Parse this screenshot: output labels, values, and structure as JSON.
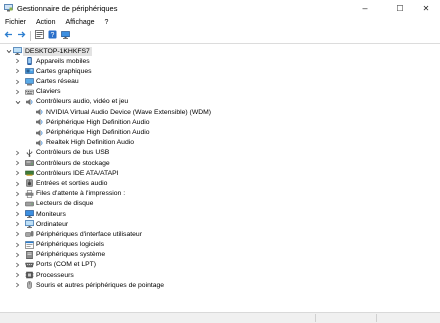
{
  "window": {
    "title": "Gestionnaire de périphériques",
    "controls": {
      "minimize": "–",
      "maximize": "☐",
      "close": "✕"
    }
  },
  "menu": [
    {
      "label": "Fichier"
    },
    {
      "label": "Action"
    },
    {
      "label": "Affichage"
    },
    {
      "label": "?"
    }
  ],
  "toolbar": [
    {
      "name": "back-button",
      "icon": "arrow-left-icon"
    },
    {
      "name": "forward-button",
      "icon": "arrow-right-icon"
    },
    {
      "sep": true
    },
    {
      "name": "properties-button",
      "icon": "properties-icon"
    },
    {
      "name": "help-button",
      "icon": "help-icon"
    },
    {
      "name": "scan-hardware-button",
      "icon": "monitor-icon"
    }
  ],
  "tree": {
    "root": {
      "label": "DESKTOP-1KHKFS7",
      "icon": "computer-icon",
      "expanded": true
    },
    "items": [
      {
        "label": "Appareils mobiles",
        "icon": "mobile-device-icon",
        "level": 1,
        "state": "collapsed"
      },
      {
        "label": "Cartes graphiques",
        "icon": "display-adapter-icon",
        "level": 1,
        "state": "collapsed"
      },
      {
        "label": "Cartes réseau",
        "icon": "network-adapter-icon",
        "level": 1,
        "state": "collapsed"
      },
      {
        "label": "Claviers",
        "icon": "keyboard-icon",
        "level": 1,
        "state": "collapsed"
      },
      {
        "label": "Contrôleurs audio, vidéo et jeu",
        "icon": "audio-icon",
        "level": 1,
        "state": "expanded"
      },
      {
        "label": "NVIDIA Virtual Audio Device (Wave Extensible) (WDM)",
        "icon": "audio-icon",
        "level": 2,
        "state": "leaf"
      },
      {
        "label": "Périphérique High Definition Audio",
        "icon": "audio-icon",
        "level": 2,
        "state": "leaf"
      },
      {
        "label": "Périphérique High Definition Audio",
        "icon": "audio-icon",
        "level": 2,
        "state": "leaf"
      },
      {
        "label": "Realtek High Definition Audio",
        "icon": "audio-icon",
        "level": 2,
        "state": "leaf"
      },
      {
        "label": "Contrôleurs de bus USB",
        "icon": "usb-icon",
        "level": 1,
        "state": "collapsed"
      },
      {
        "label": "Contrôleurs de stockage",
        "icon": "storage-controller-icon",
        "level": 1,
        "state": "collapsed"
      },
      {
        "label": "Contrôleurs IDE ATA/ATAPI",
        "icon": "ide-controller-icon",
        "level": 1,
        "state": "collapsed"
      },
      {
        "label": "Entrées et sorties audio",
        "icon": "speaker-icon",
        "level": 1,
        "state": "collapsed"
      },
      {
        "label": "Files d'attente à l'impression :",
        "icon": "printer-icon",
        "level": 1,
        "state": "collapsed"
      },
      {
        "label": "Lecteurs de disque",
        "icon": "disk-drive-icon",
        "level": 1,
        "state": "collapsed"
      },
      {
        "label": "Moniteurs",
        "icon": "monitor-icon",
        "level": 1,
        "state": "collapsed"
      },
      {
        "label": "Ordinateur",
        "icon": "computer-icon",
        "level": 1,
        "state": "collapsed"
      },
      {
        "label": "Périphériques d'interface utilisateur",
        "icon": "hid-icon",
        "level": 1,
        "state": "collapsed"
      },
      {
        "label": "Périphériques logiciels",
        "icon": "software-device-icon",
        "level": 1,
        "state": "collapsed"
      },
      {
        "label": "Périphériques système",
        "icon": "system-device-icon",
        "level": 1,
        "state": "collapsed"
      },
      {
        "label": "Ports (COM et LPT)",
        "icon": "port-icon",
        "level": 1,
        "state": "collapsed"
      },
      {
        "label": "Processeurs",
        "icon": "processor-icon",
        "level": 1,
        "state": "collapsed"
      },
      {
        "label": "Souris et autres périphériques de pointage",
        "icon": "mouse-icon",
        "level": 1,
        "state": "collapsed"
      }
    ]
  },
  "colors": {
    "accent": "#1e6fc9",
    "selection": "#e3e3e3",
    "chrome": "#f0f0f0"
  }
}
